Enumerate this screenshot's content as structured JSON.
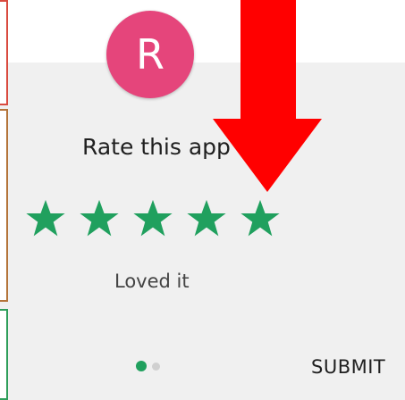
{
  "dialog": {
    "avatar_letter": "R",
    "title": "Rate this app",
    "rating": 5,
    "max_rating": 5,
    "rating_label": "Loved it",
    "pager": {
      "pages": 2,
      "current": 1
    },
    "submit_label": "SUBMIT"
  },
  "colors": {
    "avatar": "#e5457b",
    "star": "#20a05e",
    "dot_active": "#20a05e",
    "dot_inactive": "#d0d0d0",
    "annotation_arrow": "#ff0000"
  },
  "icons": {
    "star": "star-icon",
    "arrow": "arrow-down-icon"
  }
}
